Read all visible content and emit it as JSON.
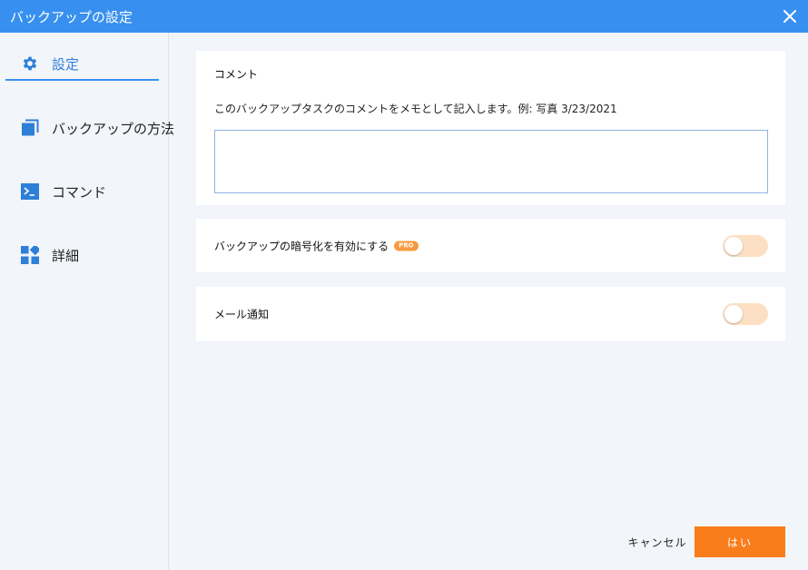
{
  "window": {
    "title": "バックアップの設定",
    "title_bg": "#3790ef"
  },
  "sidebar": {
    "items": [
      {
        "label": "設定",
        "icon": "gear-icon",
        "active": true
      },
      {
        "label": "バックアップの方法",
        "icon": "copy-icon",
        "active": false
      },
      {
        "label": "コマンド",
        "icon": "terminal-icon",
        "active": false
      },
      {
        "label": "詳細",
        "icon": "grid-icon",
        "active": false
      }
    ]
  },
  "comment": {
    "title": "コメント",
    "description": "このバックアップタスクのコメントをメモとして記入します。例: 写真 3/23/2021",
    "value": "",
    "placeholder": ""
  },
  "encryption": {
    "label": "バックアップの暗号化を有効にする",
    "badge": "PRO",
    "enabled": false
  },
  "mail": {
    "label": "メール通知",
    "enabled": false
  },
  "footer": {
    "cancel_label": "キャンセル",
    "ok_label": "はい",
    "ok_color": "#fa7d1b"
  }
}
